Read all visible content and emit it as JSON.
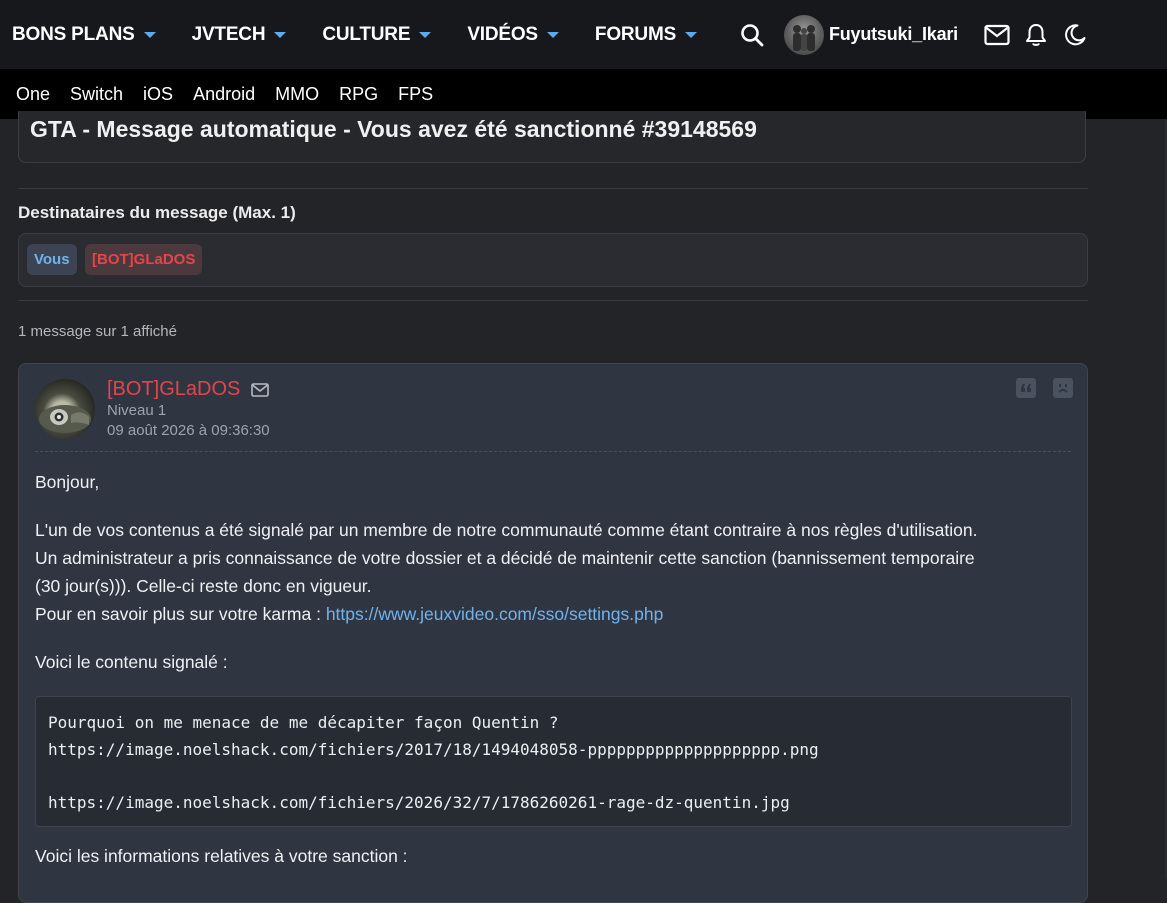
{
  "top_nav": {
    "menus": [
      {
        "label": "BONS PLANS"
      },
      {
        "label": "JVTECH"
      },
      {
        "label": "CULTURE"
      },
      {
        "label": "VIDÉOS"
      },
      {
        "label": "FORUMS"
      }
    ],
    "username": "Fuyutsuki_Ikari",
    "icons": [
      "search-icon",
      "avatar",
      "mail-icon",
      "bell-icon",
      "moon-icon"
    ],
    "accent_color": "#5da9f0"
  },
  "sub_nav": {
    "items": [
      "One",
      "Switch",
      "iOS",
      "Android",
      "MMO",
      "RPG",
      "FPS"
    ]
  },
  "conversation": {
    "title": "GTA - Message automatique - Vous avez été sanctionné #39148569",
    "recipients_label": "Destinataires du message (Max. 1)",
    "recipients": [
      "Vous",
      "[BOT]GLaDOS"
    ],
    "count_text": "1 message sur 1 affiché"
  },
  "message": {
    "author": "[BOT]GLaDOS",
    "author_color": "#e3454b",
    "level": "Niveau 1",
    "date": "09 août 2026 à 09:36:30",
    "greeting": "Bonjour,",
    "para1_line1": "L'un de vos contenus a été signalé par un membre de notre communauté comme étant contraire à nos règles d'utilisation.",
    "para1_line2": "Un administrateur a pris connaissance de votre dossier et a décidé de maintenir cette sanction (bannissement temporaire",
    "para1_line3": "(30 jour(s))). Celle-ci reste donc en vigueur.",
    "para1_karma_prefix": "Pour en savoir plus sur votre karma : ",
    "karma_link": "https://www.jeuxvideo.com/sso/settings.php",
    "reported_label": "Voici le contenu signalé :",
    "code_lines": [
      "Pourquoi on me menace de me décapiter façon Quentin ?",
      "https://image.noelshack.com/fichiers/2017/18/1494048058-pppppppppppppppppppp.png",
      "",
      "https://image.noelshack.com/fichiers/2026/32/7/1786260261-rage-dz-quentin.jpg"
    ],
    "sanction_label": "Voici les informations relatives à votre sanction :"
  }
}
